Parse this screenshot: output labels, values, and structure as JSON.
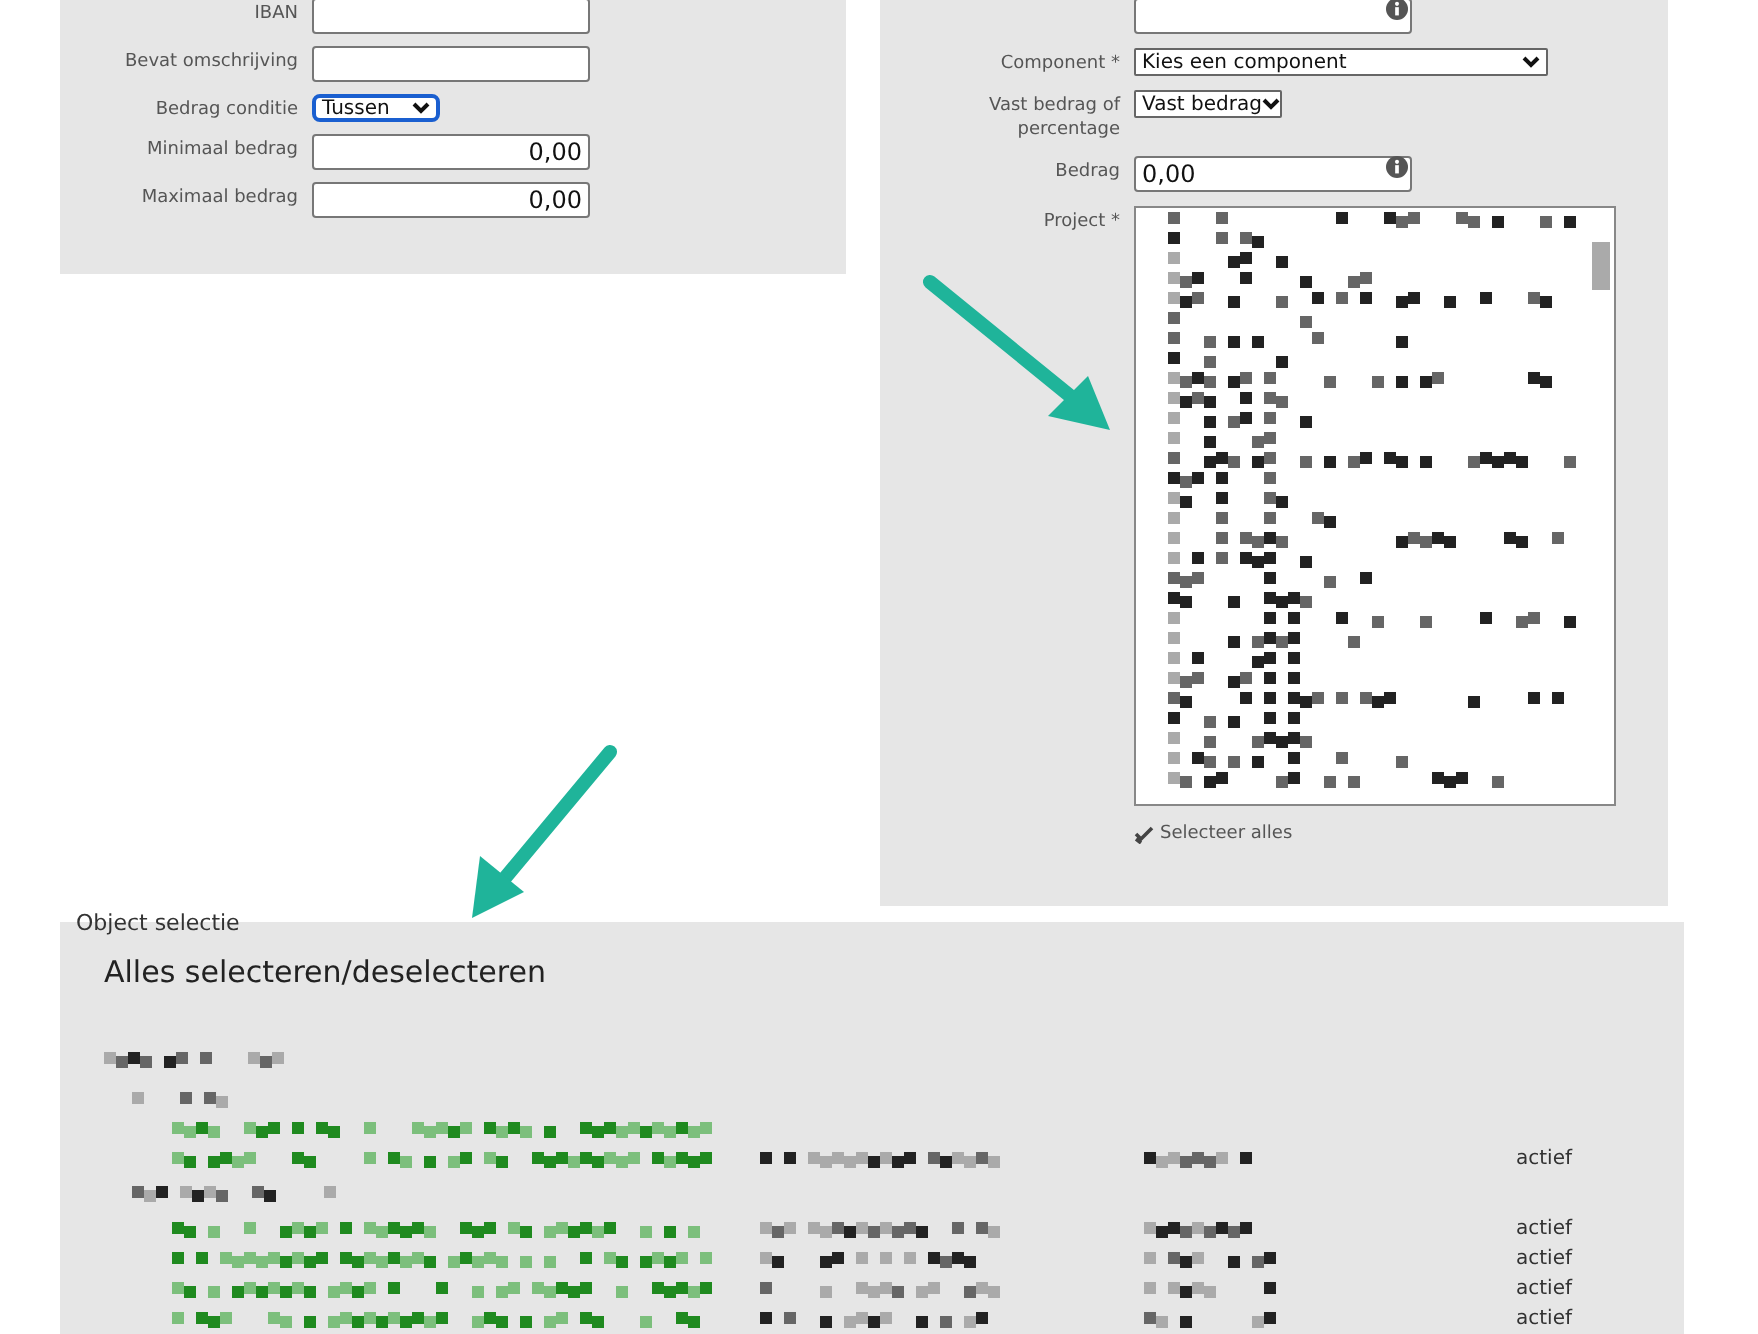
{
  "filter_panel": {
    "fields": [
      {
        "kind": "input",
        "label": "IBAN"
      },
      {
        "kind": "input",
        "label": "Bevat omschrijving"
      },
      {
        "kind": "select",
        "label": "Bedrag conditie",
        "value": "Tussen",
        "focused": true
      },
      {
        "kind": "amount",
        "label": "Minimaal bedrag",
        "value": "0,00"
      },
      {
        "kind": "amount",
        "label": "Maximaal bedrag",
        "value": "0,00"
      }
    ]
  },
  "rule_panel": {
    "fields": [
      {
        "kind": "info-input"
      },
      {
        "kind": "wide-select",
        "label": "Component *",
        "value": "Kies een component"
      },
      {
        "kind": "select",
        "label": "Vast bedrag of percentage",
        "value": "Vast bedrag"
      },
      {
        "kind": "info-input",
        "label": "Bedrag",
        "value": "0,00"
      },
      {
        "kind": "listbox",
        "label": "Project *"
      }
    ],
    "select_all": "Selecteer alles"
  },
  "object_selection": {
    "legend": "Object selectie",
    "heading": "Alles selecteren/deselecteren",
    "rows": [
      {
        "kind": "group"
      },
      {
        "kind": "subgroup"
      },
      {
        "kind": "item"
      },
      {
        "kind": "item",
        "status": "actief"
      },
      {
        "kind": "subgroup"
      },
      {
        "kind": "item",
        "status": "actief"
      },
      {
        "kind": "item",
        "status": "actief"
      },
      {
        "kind": "item",
        "status": "actief"
      },
      {
        "kind": "item",
        "status": "actief"
      }
    ]
  }
}
